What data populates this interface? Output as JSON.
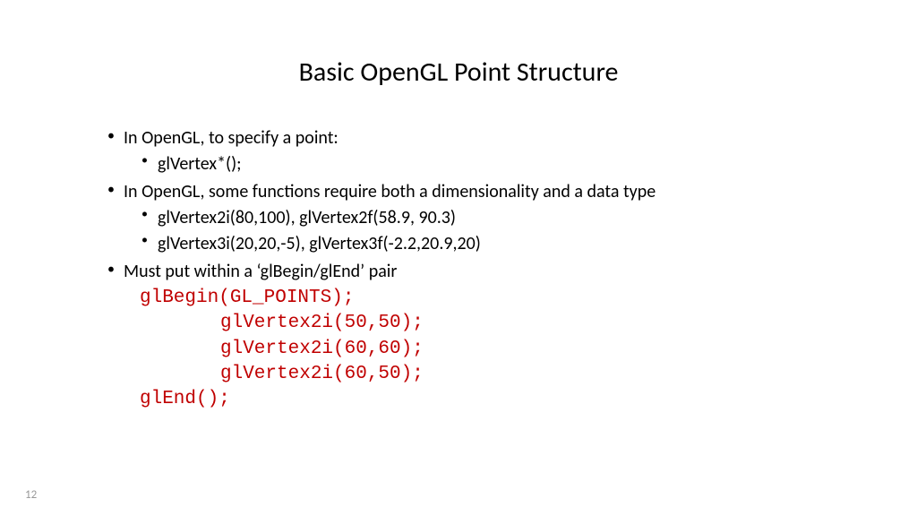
{
  "title": "Basic OpenGL Point Structure",
  "bullets": {
    "b1": "In OpenGL, to specify a point:",
    "b1_s1": "glVertex*();",
    "b2": "In OpenGL, some functions require both a dimensionality and a data type",
    "b2_s1": "glVertex2i(80,100), glVertex2f(58.9, 90.3)",
    "b2_s2": "glVertex3i(20,20,-5), glVertex3f(-2.2,20.9,20)",
    "b3": "Must put within a ‘glBegin/glEnd’ pair"
  },
  "code": {
    "l1": "glBegin(GL_POINTS);",
    "l2": "glVertex2i(50,50);",
    "l3": "glVertex2i(60,60);",
    "l4": "glVertex2i(60,50);",
    "l5": "glEnd();"
  },
  "page": "12"
}
